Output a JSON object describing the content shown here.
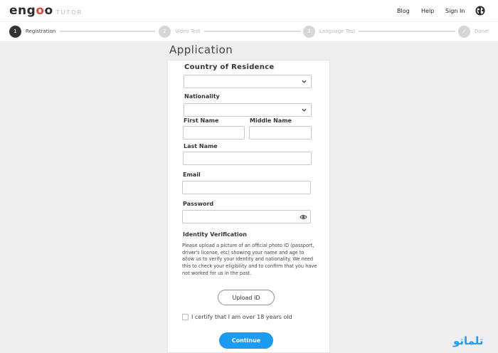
{
  "header": {
    "logo_main_prefix": "eng",
    "logo_main_o1": "o",
    "logo_main_o2": "o",
    "logo_sub": "TUTOR",
    "nav": {
      "blog": "Blog",
      "help": "Help",
      "sign_in": "Sign In"
    },
    "globe_icon": "globe-icon"
  },
  "progress": {
    "steps": [
      {
        "number": "1",
        "label": "Registration",
        "active": true
      },
      {
        "number": "2",
        "label": "Video Test",
        "active": false
      },
      {
        "number": "3",
        "label": "Language Test",
        "active": false
      },
      {
        "number": "✓",
        "label": "Done!",
        "active": false
      }
    ]
  },
  "page": {
    "title": "Application"
  },
  "form": {
    "country_label": "Country of Residence",
    "country_value": "",
    "nationality_label": "Nationality",
    "nationality_value": "",
    "first_name_label": "First Name",
    "first_name_value": "",
    "middle_name_label": "Middle Name",
    "middle_name_value": "",
    "last_name_label": "Last Name",
    "last_name_value": "",
    "email_label": "Email",
    "email_value": "",
    "password_label": "Password",
    "password_value": "",
    "identity_label": "Identity Verification",
    "identity_description": "Please upload a picture of an official photo ID (passport, driver's license, etc) showing your name and age to allow us to verify your identity and nationality. We need this to check your eligibility and to confirm that you have not worked for us in the past.",
    "upload_button": "Upload ID",
    "certify_label": "I certify that I am over 18 years old",
    "certify_checked": false,
    "continue_button": "Continue"
  },
  "watermark": "تلماتو",
  "colors": {
    "accent": "#1d9bf0",
    "logo_red": "#e0463a",
    "background": "#eeeeee"
  }
}
